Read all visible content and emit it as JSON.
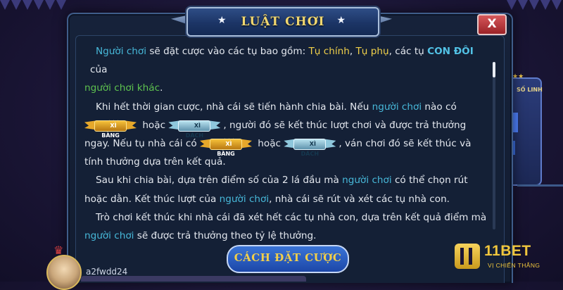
{
  "dialog": {
    "title": "LUẬT CHƠI",
    "close_label": "X",
    "footer_button": "CÁCH ĐẶT CƯỢC"
  },
  "rules": {
    "p1": {
      "s1": "Người chơi",
      "s2": " sẽ đặt cược vào các tụ bao gồm: ",
      "s3": "Tụ chính",
      "s4": ", ",
      "s5": "Tụ phụ",
      "s6": ", các tụ ",
      "s7": "CON ĐÔI",
      "s8": " của",
      "s9": "người chơi khác",
      "s10": "."
    },
    "p2": {
      "s1": "Khi hết thời gian cược, nhà cái sẽ tiến hành chia bài. Nếu ",
      "s2": "người chơi",
      "s3": " nào có",
      "s4": " hoặc ",
      "s5": ", người đó sẽ kết thúc lượt chơi và được trả thưởng",
      "s6": "ngay. Nếu tụ nhà cái có ",
      "s7": " hoặc ",
      "s8": ", ván chơi đó sẽ kết thúc và",
      "s9": "tính thưởng dựa trên kết quả."
    },
    "p3": {
      "s1": "Sau khi chia bài, dựa trên điểm số của 2 lá đầu mà ",
      "s2": "người chơi",
      "s3": " có thể chọn rút",
      "s4": "hoặc dằn. Kết thúc lượt của ",
      "s5": "người chơi",
      "s6": ", nhà cái sẽ rút và xét các tụ nhà con."
    },
    "p4": {
      "s1": "Trò chơi kết thúc khi nhà cái đã xét hết các tụ nhà con, dựa trên kết quả điểm mà",
      "s2": "người chơi",
      "s3": " sẽ được trả thưởng theo tỷ lệ thưởng."
    }
  },
  "badges": {
    "xi_bang": "XÌ BÀNG",
    "xi_dach": "XÌ DÁCH",
    "stars": "★★★"
  },
  "side_panel": {
    "label": "SỐ LINH",
    "stars": "★★"
  },
  "player": {
    "name": "a2fwdd24"
  },
  "logo": {
    "brand": "11BET",
    "tagline": "VỊ CHIẾN THẮNG"
  },
  "colors": {
    "highlight_blue": "#47b8d9",
    "highlight_yellow": "#f0d04a",
    "highlight_green": "#5ec24f",
    "title_gold": "#f1d770",
    "close_red": "#9b2227"
  }
}
